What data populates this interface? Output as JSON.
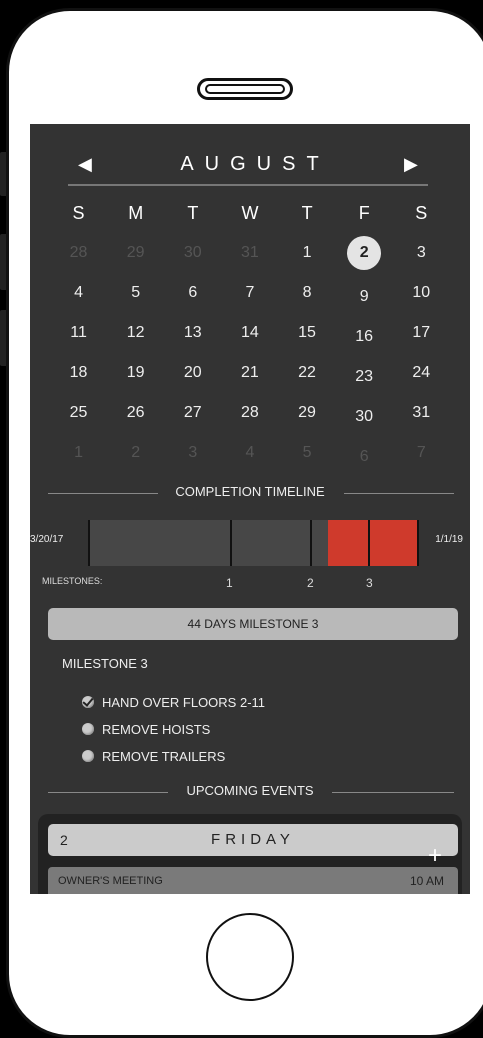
{
  "calendar": {
    "month": "AUGUST",
    "prev_icon": "◀",
    "next_icon": "▶",
    "weekdays": [
      "S",
      "M",
      "T",
      "W",
      "T",
      "F",
      "S"
    ],
    "weeks": [
      [
        "28",
        "29",
        "30",
        "31",
        "1",
        "2",
        "3"
      ],
      [
        "4",
        "5",
        "6",
        "7",
        "8",
        "9",
        "10"
      ],
      [
        "11",
        "12",
        "13",
        "14",
        "15",
        "16",
        "17"
      ],
      [
        "18",
        "19",
        "20",
        "21",
        "22",
        "23",
        "24"
      ],
      [
        "25",
        "26",
        "27",
        "28",
        "29",
        "30",
        "31"
      ],
      [
        "1",
        "2",
        "3",
        "4",
        "5",
        "6",
        "7"
      ]
    ],
    "selected_day": "2"
  },
  "timeline": {
    "title": "COMPLETION TIMELINE",
    "start_date": "3/20/17",
    "end_date": "1/1/19",
    "milestones_label": "MILESTONES:",
    "milestones": [
      "1",
      "2",
      "3"
    ]
  },
  "days_bar": "44 DAYS MILESTONE 3",
  "milestone": {
    "title": "MILESTONE 3",
    "tasks": [
      {
        "label": "HAND OVER FLOORS 2-11",
        "checked": true
      },
      {
        "label": "REMOVE HOISTS",
        "checked": false
      },
      {
        "label": "REMOVE TRAILERS",
        "checked": false
      }
    ]
  },
  "events": {
    "title": "UPCOMING EVENTS",
    "day_number": "2",
    "day_name": "FRIDAY",
    "add_icon": "+",
    "items": [
      {
        "name": "OWNER'S MEETING",
        "time": "10 AM"
      }
    ]
  },
  "colors": {
    "screen_bg": "#333333",
    "timeline_red": "#cf3a2c",
    "selected_circle": "#e4e4e4"
  }
}
